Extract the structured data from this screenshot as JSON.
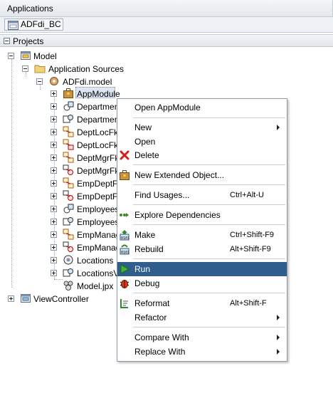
{
  "applications_panel": {
    "title": "Applications"
  },
  "project_selector": {
    "value": "ADFdi_BC"
  },
  "projects_panel": {
    "title": "Projects"
  },
  "tree": {
    "model": "Model",
    "application_sources": "Application Sources",
    "package": "ADFdi.model",
    "items": [
      "AppModule",
      "Departmen",
      "Departmen",
      "DeptLocFkA",
      "DeptLocFkL",
      "DeptMgrFk",
      "DeptMgrFk",
      "EmpDeptFk",
      "EmpDeptFk",
      "Employees",
      "Employees'",
      "EmpManag",
      "EmpManag",
      "Locations",
      "LocationsVi"
    ],
    "model_jpx": "Model.jpx",
    "view_controller": "ViewController"
  },
  "context_menu": {
    "open_appmodule": "Open AppModule",
    "new": "New",
    "open": "Open",
    "delete": "Delete",
    "new_extended_object": "New Extended Object...",
    "find_usages": "Find Usages...",
    "find_usages_shortcut": "Ctrl+Alt-U",
    "explore_dependencies": "Explore Dependencies",
    "make": "Make",
    "make_shortcut": "Ctrl+Shift-F9",
    "rebuild": "Rebuild",
    "rebuild_shortcut": "Alt+Shift-F9",
    "run": "Run",
    "debug": "Debug",
    "reformat": "Reformat",
    "reformat_shortcut": "Alt+Shift-F",
    "refactor": "Refactor",
    "compare_with": "Compare With",
    "replace_with": "Replace With"
  },
  "colors": {
    "highlight": "#2f5d8c",
    "selection_bg": "#dde6f2",
    "panel_header": "#e3e7ec"
  }
}
